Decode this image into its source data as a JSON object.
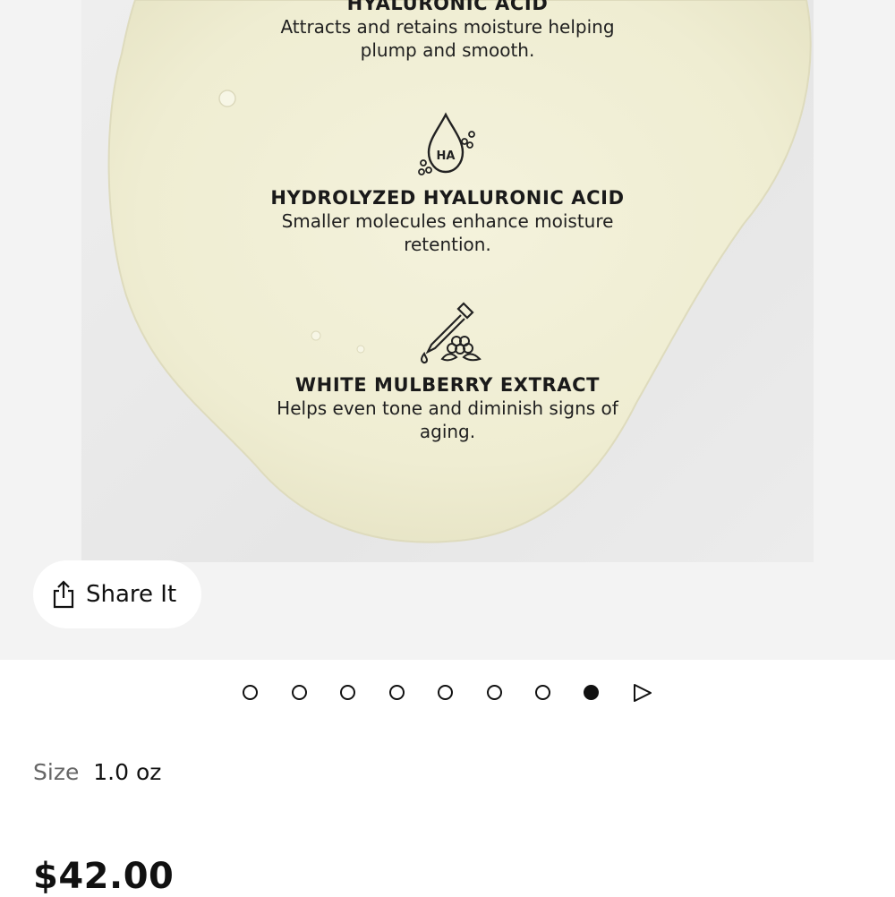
{
  "gallery": {
    "ingredients": [
      {
        "title": "HYALURONIC ACID",
        "description": "Attracts and retains moisture helping plump and smooth.",
        "icon": "none"
      },
      {
        "title": "HYDROLYZED HYALURONIC ACID",
        "description": "Smaller molecules enhance moisture retention.",
        "icon": "droplet-ha-icon",
        "icon_text": "HA"
      },
      {
        "title": "WHITE MULBERRY EXTRACT",
        "description": "Helps even tone and diminish signs of aging.",
        "icon": "dropper-berry-icon"
      }
    ],
    "share_label": "Share It",
    "pagination": {
      "total": 8,
      "active": 8
    }
  },
  "product": {
    "size_label": "Size",
    "size_value": "1.0 oz",
    "price": "$42.00"
  },
  "colors": {
    "gallery_bg": "#f3f3f3",
    "serum": "#f2f0d8",
    "text": "#111111"
  }
}
